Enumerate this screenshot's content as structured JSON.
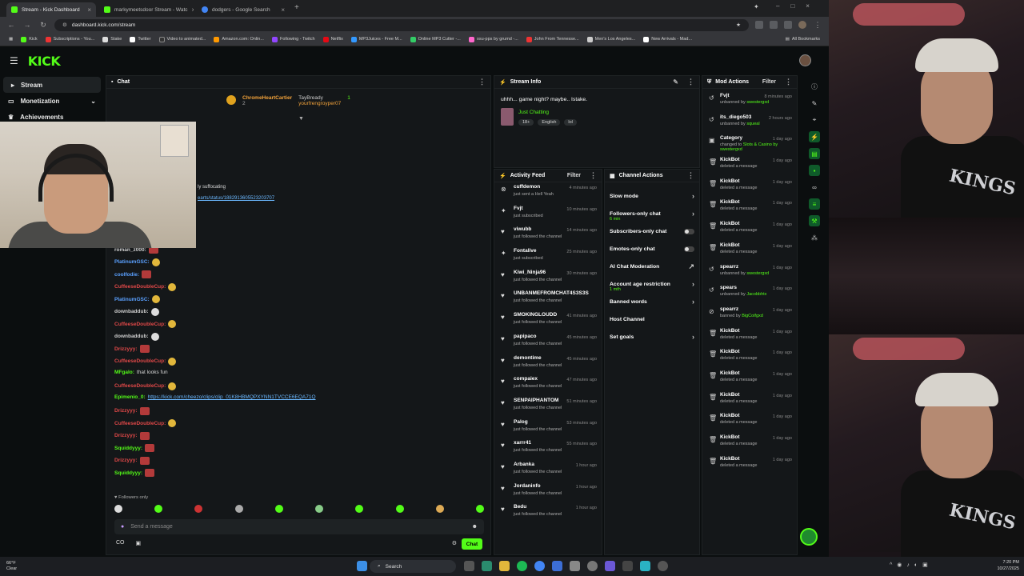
{
  "browser": {
    "tabs": [
      {
        "title": "Stream - Kick Dashboard",
        "active": true,
        "color": "#53fc18"
      },
      {
        "title": "markymeetsdoor Stream - Watc",
        "active": false,
        "color": "#53fc18"
      },
      {
        "title": "dodgers - Google Search",
        "active": false,
        "color": "#4285f4"
      }
    ],
    "url": "dashboard.kick.com/stream",
    "bookmarks": [
      "Kick",
      "Subscriptions - You...",
      "Stake",
      "Twitter",
      "Video to animated...",
      "Amazon.com: Onlin...",
      "Following - Twitch",
      "Netflix",
      "MP3Juices - Free M...",
      "Online MP3 Cutter -...",
      "osu-pps by grumd -...",
      "John From Tennesse...",
      "Men's Los Angeles...",
      "New Arrivals - Mad..."
    ],
    "all_bookmarks": "All Bookmarks"
  },
  "kick": {
    "logo": "KICK",
    "sidebar": [
      {
        "label": "Stream",
        "icon": "play-icon",
        "active": true
      },
      {
        "label": "Monetization",
        "icon": "card-icon",
        "active": false,
        "chevron": "⌄"
      },
      {
        "label": "Achievements",
        "icon": "trophy-icon",
        "active": false
      }
    ]
  },
  "chat": {
    "title": "Chat",
    "pinned": {
      "user1": "ChromeHeartCartier",
      "user1_count": "2",
      "user2": "TayBready",
      "user3": "yourfrengroyper07",
      "count": "1"
    },
    "overlay_text1": "ly suffocating",
    "overlay_link": "earts/status/1882913605523203707",
    "messages": [
      {
        "user": "roman_z000:",
        "color": "#cfcfcf",
        "text": "",
        "emote": "red"
      },
      {
        "user": "PlatinumGSC:",
        "color": "#5aa0ff",
        "text": "",
        "emote": "yel"
      },
      {
        "user": "coolfodie:",
        "color": "#5aa0ff",
        "text": "",
        "emote": "red"
      },
      {
        "user": "CuffeeseDoubleCup:",
        "color": "#e04848",
        "text": "",
        "emote": "yel"
      },
      {
        "user": "PlatinumGSC:",
        "color": "#5aa0ff",
        "text": "",
        "emote": "yel"
      },
      {
        "user": "downbaddub:",
        "color": "#cfcfcf",
        "text": "",
        "emote": "wht"
      },
      {
        "user": "CuffeeseDoubleCup:",
        "color": "#e04848",
        "text": "",
        "emote": "yel"
      },
      {
        "user": "downbaddub:",
        "color": "#cfcfcf",
        "text": "",
        "emote": "wht"
      },
      {
        "user": "Drizzyyy:",
        "color": "#e04848",
        "text": "",
        "emote": "red"
      },
      {
        "user": "CuffeeseDoubleCup:",
        "color": "#e04848",
        "text": "",
        "emote": "yel"
      },
      {
        "user": "MFgalo:",
        "color": "#53fc18",
        "text": "that looks fun",
        "emote": ""
      },
      {
        "user": "CuffeeseDoubleCup:",
        "color": "#e04848",
        "text": "",
        "emote": "yel"
      },
      {
        "user": "Epimenio_0:",
        "color": "#53fc18",
        "text": "https://kick.com/cheezo/clips/clip_01K8HBMQPXYNN1TVCCE6EQA71Q",
        "emote": "",
        "link": true
      },
      {
        "user": "Drizzyyy:",
        "color": "#e04848",
        "text": "",
        "emote": "red"
      },
      {
        "user": "CuffeeseDoubleCup:",
        "color": "#e04848",
        "text": "",
        "emote": "yel"
      },
      {
        "user": "Drizzyyy:",
        "color": "#e04848",
        "text": "",
        "emote": "red"
      },
      {
        "user": "Squiddyyy:",
        "color": "#53fc18",
        "text": "",
        "emote": "red"
      },
      {
        "user": "Drizzyyy:",
        "color": "#e04848",
        "text": "",
        "emote": "red"
      },
      {
        "user": "Squiddyyy:",
        "color": "#53fc18",
        "text": "",
        "emote": "red"
      }
    ],
    "followers_only": "Followers only",
    "input_placeholder": "Send a message",
    "send_label": "Chat",
    "bottom_left": "CO"
  },
  "stream_info": {
    "title": "Stream Info",
    "stream_title": "uhhh... game night? maybe.. Istake.",
    "category": "Just Chatting",
    "tags": [
      "18+",
      "English",
      "lol"
    ]
  },
  "activity_feed": {
    "title": "Activity Feed",
    "filter": "Filter",
    "items": [
      {
        "name": "cuffdemon",
        "time": "4 minutes ago",
        "desc": "just sent a Hell Yeah",
        "icon": "kick-icon"
      },
      {
        "name": "Fvjt",
        "time": "10 minutes ago",
        "desc": "just subscribed",
        "icon": "star-icon"
      },
      {
        "name": "viwubb",
        "time": "14 minutes ago",
        "desc": "just followed the channel",
        "icon": "heart-icon"
      },
      {
        "name": "Fontalive",
        "time": "25 minutes ago",
        "desc": "just subscribed",
        "icon": "star-icon"
      },
      {
        "name": "Kiwi_Ninja96",
        "time": "30 minutes ago",
        "desc": "just followed the channel",
        "icon": "heart-icon"
      },
      {
        "name": "UNBANMEFROMCHAT4S3S3S",
        "time": "",
        "desc": "just followed the channel",
        "icon": "heart-icon"
      },
      {
        "name": "SMOKINGLOUDD",
        "time": "41 minutes ago",
        "desc": "just followed the channel",
        "icon": "heart-icon"
      },
      {
        "name": "papipaco",
        "time": "45 minutes ago",
        "desc": "just followed the channel",
        "icon": "heart-icon"
      },
      {
        "name": "demontime",
        "time": "45 minutes ago",
        "desc": "just followed the channel",
        "icon": "heart-icon"
      },
      {
        "name": "compaiex",
        "time": "47 minutes ago",
        "desc": "just followed the channel",
        "icon": "heart-icon"
      },
      {
        "name": "SENPAIPHANTOM",
        "time": "51 minutes ago",
        "desc": "just followed the channel",
        "icon": "heart-icon"
      },
      {
        "name": "Palog",
        "time": "53 minutes ago",
        "desc": "just followed the channel",
        "icon": "heart-icon"
      },
      {
        "name": "xarrr41",
        "time": "55 minutes ago",
        "desc": "just followed the channel",
        "icon": "heart-icon"
      },
      {
        "name": "Arbanka",
        "time": "1 hour ago",
        "desc": "just followed the channel",
        "icon": "heart-icon"
      },
      {
        "name": "Jordaninfo",
        "time": "1 hour ago",
        "desc": "just followed the channel",
        "icon": "heart-icon"
      },
      {
        "name": "Bedu",
        "time": "1 hour ago",
        "desc": "just followed the channel",
        "icon": "heart-icon"
      }
    ]
  },
  "channel_actions": {
    "title": "Channel Actions",
    "items": [
      {
        "label": "Slow mode",
        "control": "›"
      },
      {
        "label": "Followers-only chat",
        "sub": "6 min",
        "control": "›"
      },
      {
        "label": "Subscribers-only chat",
        "control": "toggle"
      },
      {
        "label": "Emotes-only chat",
        "control": "toggle"
      },
      {
        "label": "AI Chat Moderation",
        "control": "↗"
      },
      {
        "label": "Account age restriction",
        "sub": "1 mth",
        "control": "›"
      },
      {
        "label": "Banned words",
        "control": "›"
      },
      {
        "label": "Host Channel",
        "control": ""
      },
      {
        "label": "Set goals",
        "control": "›"
      }
    ]
  },
  "mod_actions": {
    "title": "Mod Actions",
    "filter": "Filter",
    "items": [
      {
        "name": "Fvjt",
        "time": "8 minutes ago",
        "desc": "unbanned by",
        "actor": "swestergxd",
        "icon": "unban-icon"
      },
      {
        "name": "its_diego503",
        "time": "2 hours ago",
        "desc": "unbanned by",
        "actor": "squeal",
        "icon": "unban-icon"
      },
      {
        "name": "Category",
        "time": "1 day ago",
        "desc": "changed to",
        "actor": "Slots & Casino by swestergxd",
        "icon": "category-icon"
      },
      {
        "name": "KickBot",
        "time": "1 day ago",
        "desc": "deleted a message",
        "actor": "",
        "icon": "trash-icon"
      },
      {
        "name": "KickBot",
        "time": "1 day ago",
        "desc": "deleted a message",
        "actor": "",
        "icon": "trash-icon"
      },
      {
        "name": "KickBot",
        "time": "1 day ago",
        "desc": "deleted a message",
        "actor": "",
        "icon": "trash-icon"
      },
      {
        "name": "KickBot",
        "time": "1 day ago",
        "desc": "deleted a message",
        "actor": "",
        "icon": "trash-icon"
      },
      {
        "name": "KickBot",
        "time": "1 day ago",
        "desc": "deleted a message",
        "actor": "",
        "icon": "trash-icon"
      },
      {
        "name": "spearrz",
        "time": "1 day ago",
        "desc": "unbanned by",
        "actor": "swestergxd",
        "icon": "unban-icon"
      },
      {
        "name": "spears",
        "time": "1 day ago",
        "desc": "unbanned by",
        "actor": "Jacobbhtx",
        "icon": "unban-icon"
      },
      {
        "name": "spearrz",
        "time": "1 day ago",
        "desc": "banned by",
        "actor": "BigCoifgxd",
        "icon": "ban-icon"
      },
      {
        "name": "KickBot",
        "time": "1 day ago",
        "desc": "deleted a message",
        "actor": "",
        "icon": "trash-icon"
      },
      {
        "name": "KickBot",
        "time": "1 day ago",
        "desc": "deleted a message",
        "actor": "",
        "icon": "trash-icon"
      },
      {
        "name": "KickBot",
        "time": "1 day ago",
        "desc": "deleted a message",
        "actor": "",
        "icon": "trash-icon"
      },
      {
        "name": "KickBot",
        "time": "1 day ago",
        "desc": "deleted a message",
        "actor": "",
        "icon": "trash-icon"
      },
      {
        "name": "KickBot",
        "time": "1 day ago",
        "desc": "deleted a message",
        "actor": "",
        "icon": "trash-icon"
      },
      {
        "name": "KickBot",
        "time": "1 day ago",
        "desc": "deleted a message",
        "actor": "",
        "icon": "trash-icon"
      },
      {
        "name": "KickBot",
        "time": "1 day ago",
        "desc": "deleted a message",
        "actor": "",
        "icon": "trash-icon"
      }
    ]
  },
  "taskbar": {
    "weather_temp": "66°F",
    "weather_desc": "Clear",
    "search": "Search",
    "time": "7:20 PM",
    "date": "10/27/2025"
  },
  "colors": {
    "accent": "#53fc18",
    "bg": "#0b0e0f",
    "panel": "#141719"
  }
}
